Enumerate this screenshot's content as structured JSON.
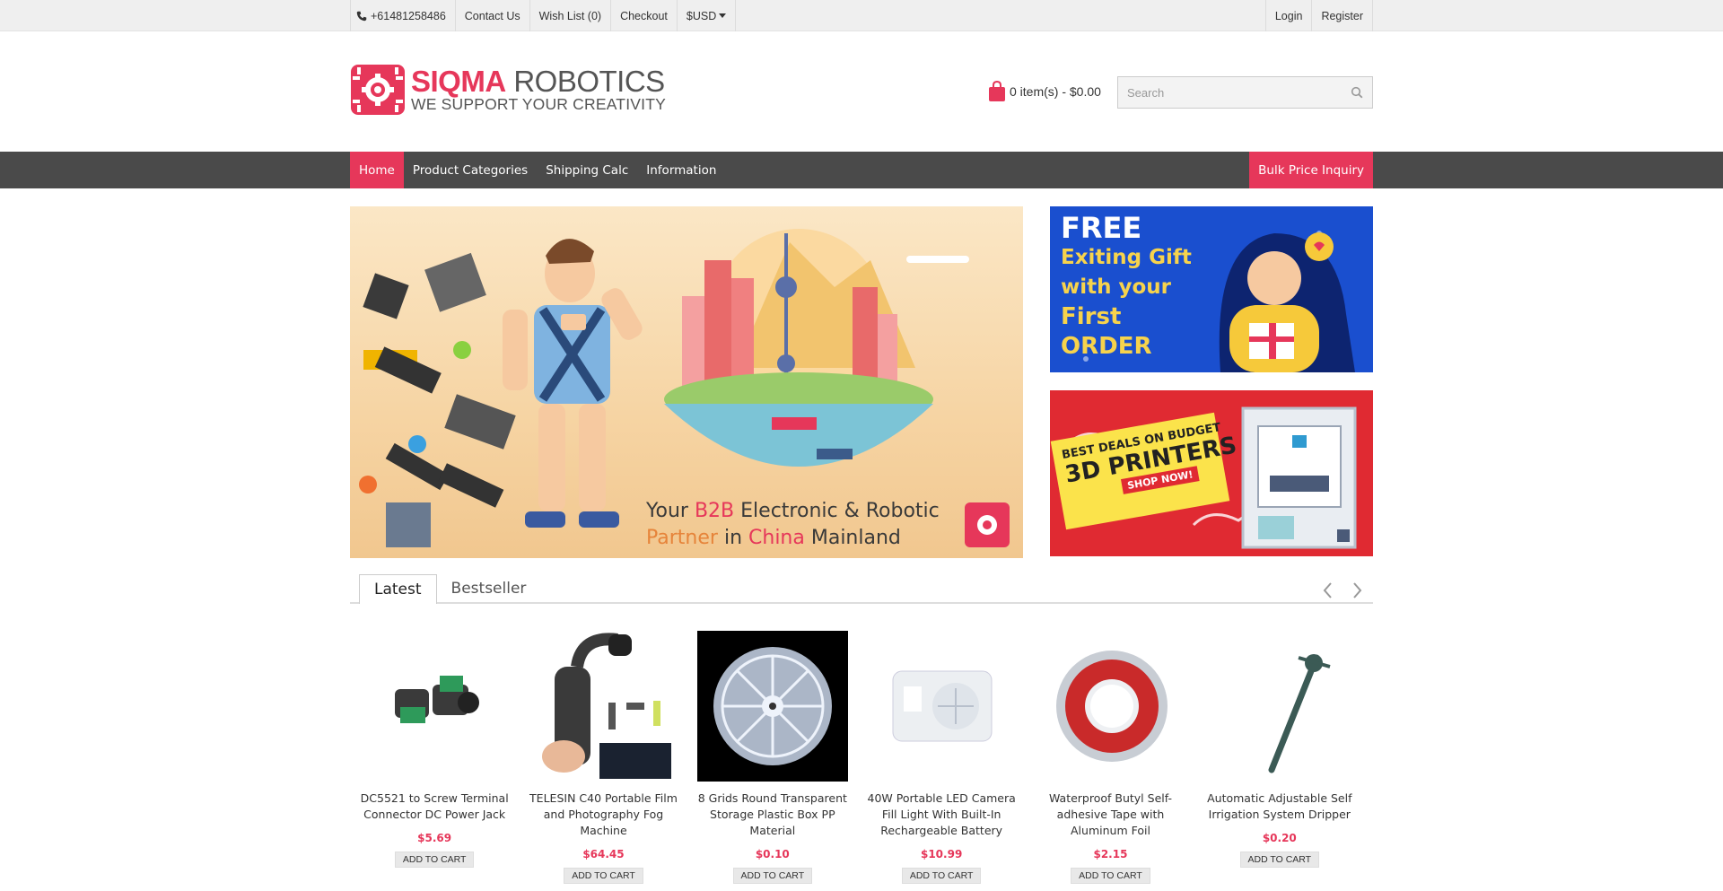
{
  "colors": {
    "brand": "#e6375a",
    "nav_bg": "#4a4a4a",
    "topbar_bg": "#efefef",
    "price": "#e6375a"
  },
  "topbar": {
    "phone_icon": "phone-icon",
    "phone": "+61481258486",
    "contact": "Contact Us",
    "wishlist": "Wish List (0)",
    "checkout": "Checkout",
    "currency": "$USD",
    "login": "Login",
    "register": "Register"
  },
  "header": {
    "logo_title_1": "SIQMA",
    "logo_title_2": " ROBOTICS",
    "logo_tagline": "WE SUPPORT YOUR CREATIVITY",
    "cart_text": "0 item(s) - $0.00",
    "search_placeholder": "Search"
  },
  "nav": {
    "items": [
      "Home",
      "Product Categories",
      "Shipping Calc",
      "Information"
    ],
    "bulk": "Bulk Price Inquiry"
  },
  "banners": {
    "hero_line1_a": "Your ",
    "hero_line1_b": "B2B",
    "hero_line1_c": " Electronic & Robotic",
    "hero_line2_a": "Partner",
    "hero_line2_b": " in ",
    "hero_line2_c": "China",
    "hero_line2_d": " Mainland",
    "side1_l1": "FREE",
    "side1_l2": "Exiting Gift",
    "side1_l3": "with your",
    "side1_l4": "First",
    "side1_l5": "ORDER",
    "side2_a": "BEST DEALS ON  BUDGET",
    "side2_b": "3D PRINTERS",
    "side2_c": "SHOP NOW!"
  },
  "tabs": [
    "Latest",
    "Bestseller"
  ],
  "products": [
    {
      "name": "DC5521 to Screw Terminal Connector DC Power Jack",
      "price": "$5.69",
      "button": "ADD TO CART"
    },
    {
      "name": "TELESIN C40 Portable Film and Photography Fog Machine",
      "price": "$64.45",
      "button": "ADD TO CART"
    },
    {
      "name": "8 Grids Round Transparent Storage Plastic Box PP Material",
      "price": "$0.10",
      "button": "ADD TO CART"
    },
    {
      "name": "40W Portable LED Camera Fill Light With Built-In Rechargeable Battery",
      "price": "$10.99",
      "button": "ADD TO CART"
    },
    {
      "name": "Waterproof Butyl Self-adhesive Tape with Aluminum Foil",
      "price": "$2.15",
      "button": "ADD TO CART"
    },
    {
      "name": "Automatic Adjustable Self Irrigation System Dripper",
      "price": "$0.20",
      "button": "ADD TO CART"
    }
  ]
}
